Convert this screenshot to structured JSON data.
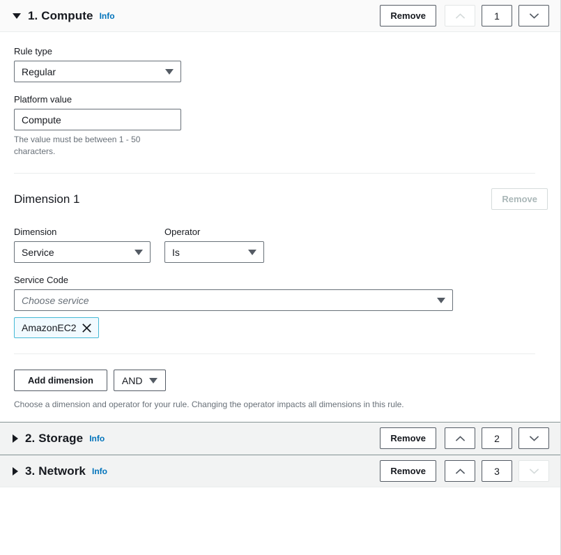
{
  "sections": [
    {
      "caret": "caret-down-icon",
      "title": "1. Compute",
      "info": "Info",
      "remove_label": "Remove",
      "order_value": "1",
      "up_enabled": false,
      "down_enabled": true,
      "expanded": true
    },
    {
      "caret": "caret-right-icon",
      "title": "2. Storage",
      "info": "Info",
      "remove_label": "Remove",
      "order_value": "2",
      "up_enabled": true,
      "down_enabled": true,
      "expanded": false
    },
    {
      "caret": "caret-right-icon",
      "title": "3. Network",
      "info": "Info",
      "remove_label": "Remove",
      "order_value": "3",
      "up_enabled": true,
      "down_enabled": false,
      "expanded": false
    }
  ],
  "form": {
    "rule_type": {
      "label": "Rule type",
      "value": "Regular"
    },
    "platform_value": {
      "label": "Platform value",
      "value": "Compute",
      "hint": "The value must be between 1 - 50 characters."
    },
    "dimension": {
      "title": "Dimension 1",
      "remove_label": "Remove",
      "remove_enabled": false,
      "dimension_label": "Dimension",
      "dimension_value": "Service",
      "operator_label": "Operator",
      "operator_value": "Is",
      "service_code_label": "Service Code",
      "service_code_placeholder": "Choose service",
      "tokens": [
        {
          "label": "AmazonEC2"
        }
      ]
    },
    "actions": {
      "add_dimension_label": "Add dimension",
      "logic_operator": "AND",
      "footnote": "Choose a dimension and operator for your rule. Changing the operator impacts all dimensions in this rule."
    }
  },
  "colors": {
    "link": "#0073bb",
    "token_border": "#44b9d6",
    "token_background": "#f1faff",
    "header_background": "#fafafa",
    "collapsed_header_background": "#f2f3f3",
    "border": "#545b64",
    "disabled": "#aab7b8",
    "text": "#16191f",
    "muted_text": "#687078"
  }
}
